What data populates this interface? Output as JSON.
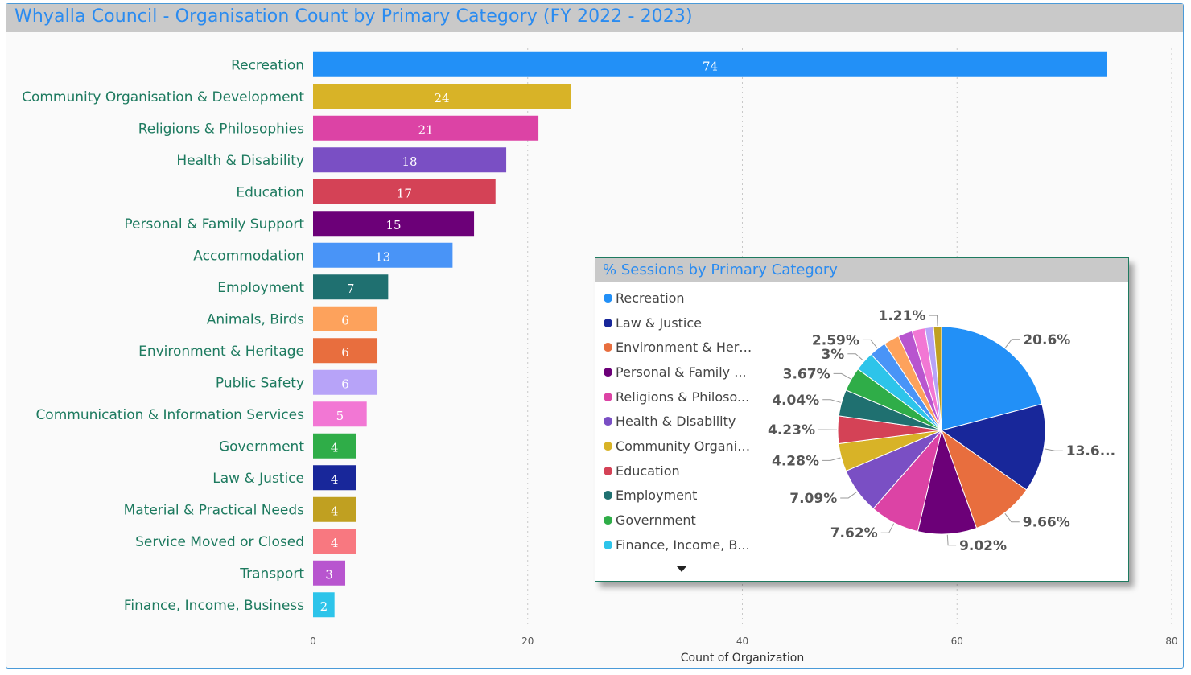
{
  "title": "Whyalla Council - Organisation Count by Primary Category (FY 2022 - 2023)",
  "chart_data": [
    {
      "type": "bar",
      "orientation": "horizontal",
      "categories": [
        "Recreation",
        "Community Organisation & Development",
        "Religions & Philosophies",
        "Health & Disability",
        "Education",
        "Personal & Family Support",
        "Accommodation",
        "Employment",
        "Animals, Birds",
        "Environment & Heritage",
        "Public Safety",
        "Communication & Information Services",
        "Government",
        "Law & Justice",
        "Material & Practical Needs",
        "Service Moved or Closed",
        "Transport",
        "Finance, Income, Business"
      ],
      "values": [
        74,
        24,
        21,
        18,
        17,
        15,
        13,
        7,
        6,
        6,
        6,
        5,
        4,
        4,
        4,
        4,
        3,
        2
      ],
      "colors": [
        "#2290f7",
        "#d8b327",
        "#dc43a5",
        "#7a4fc4",
        "#d44256",
        "#6c0078",
        "#4994f7",
        "#1f7070",
        "#fda25c",
        "#e86e3e",
        "#b7a3f8",
        "#f277d4",
        "#2fad48",
        "#18279a",
        "#c0a021",
        "#f87880",
        "#b855cf",
        "#2dc4ea"
      ],
      "xlabel": "Count of Organization",
      "xticks": [
        0,
        20,
        40,
        60,
        80
      ],
      "xlim": [
        0,
        80
      ],
      "grid": "vertical dotted"
    },
    {
      "type": "pie",
      "title": "% Sessions by Primary Category",
      "legend_position": "left",
      "legend": [
        "Recreation",
        "Law & Justice",
        "Environment & Herit...",
        "Personal & Family ...",
        "Religions & Philoso...",
        "Health & Disability",
        "Community Organis...",
        "Education",
        "Employment",
        "Government",
        "Finance, Income, B..."
      ],
      "slices": [
        {
          "name": "Recreation",
          "value": 20.6,
          "label": "20.6%",
          "color": "#2290f7"
        },
        {
          "name": "Law & Justice",
          "value": 13.6,
          "label": "13.6...",
          "color": "#18279a"
        },
        {
          "name": "Environment & Heritage",
          "value": 9.66,
          "label": "9.66%",
          "color": "#e86e3e"
        },
        {
          "name": "Personal & Family Support",
          "value": 9.02,
          "label": "9.02%",
          "color": "#6c0078"
        },
        {
          "name": "Religions & Philosophies",
          "value": 7.62,
          "label": "7.62%",
          "color": "#dc43a5"
        },
        {
          "name": "Health & Disability",
          "value": 7.09,
          "label": "7.09%",
          "color": "#7a4fc4"
        },
        {
          "name": "Community Organisation & Development",
          "value": 4.28,
          "label": "4.28%",
          "color": "#d8b327"
        },
        {
          "name": "Education",
          "value": 4.23,
          "label": "4.23%",
          "color": "#d44256"
        },
        {
          "name": "Employment",
          "value": 4.04,
          "label": "4.04%",
          "color": "#1f7070"
        },
        {
          "name": "Government",
          "value": 3.67,
          "label": "3.67%",
          "color": "#2fad48"
        },
        {
          "name": "Finance, Income, Business",
          "value": 3.0,
          "label": "3%",
          "color": "#2dc4ea"
        },
        {
          "name": "",
          "value": 2.59,
          "label": "2.59%",
          "color": "#4994f7"
        },
        {
          "name": "",
          "value": 2.4,
          "label": "",
          "color": "#fda25c"
        },
        {
          "name": "",
          "value": 2.2,
          "label": "",
          "color": "#b855cf"
        },
        {
          "name": "",
          "value": 2.0,
          "label": "",
          "color": "#f277d4"
        },
        {
          "name": "",
          "value": 1.3,
          "label": "",
          "color": "#b7a3f8"
        },
        {
          "name": "",
          "value": 1.21,
          "label": "1.21%",
          "color": "#c0a021"
        }
      ]
    }
  ]
}
